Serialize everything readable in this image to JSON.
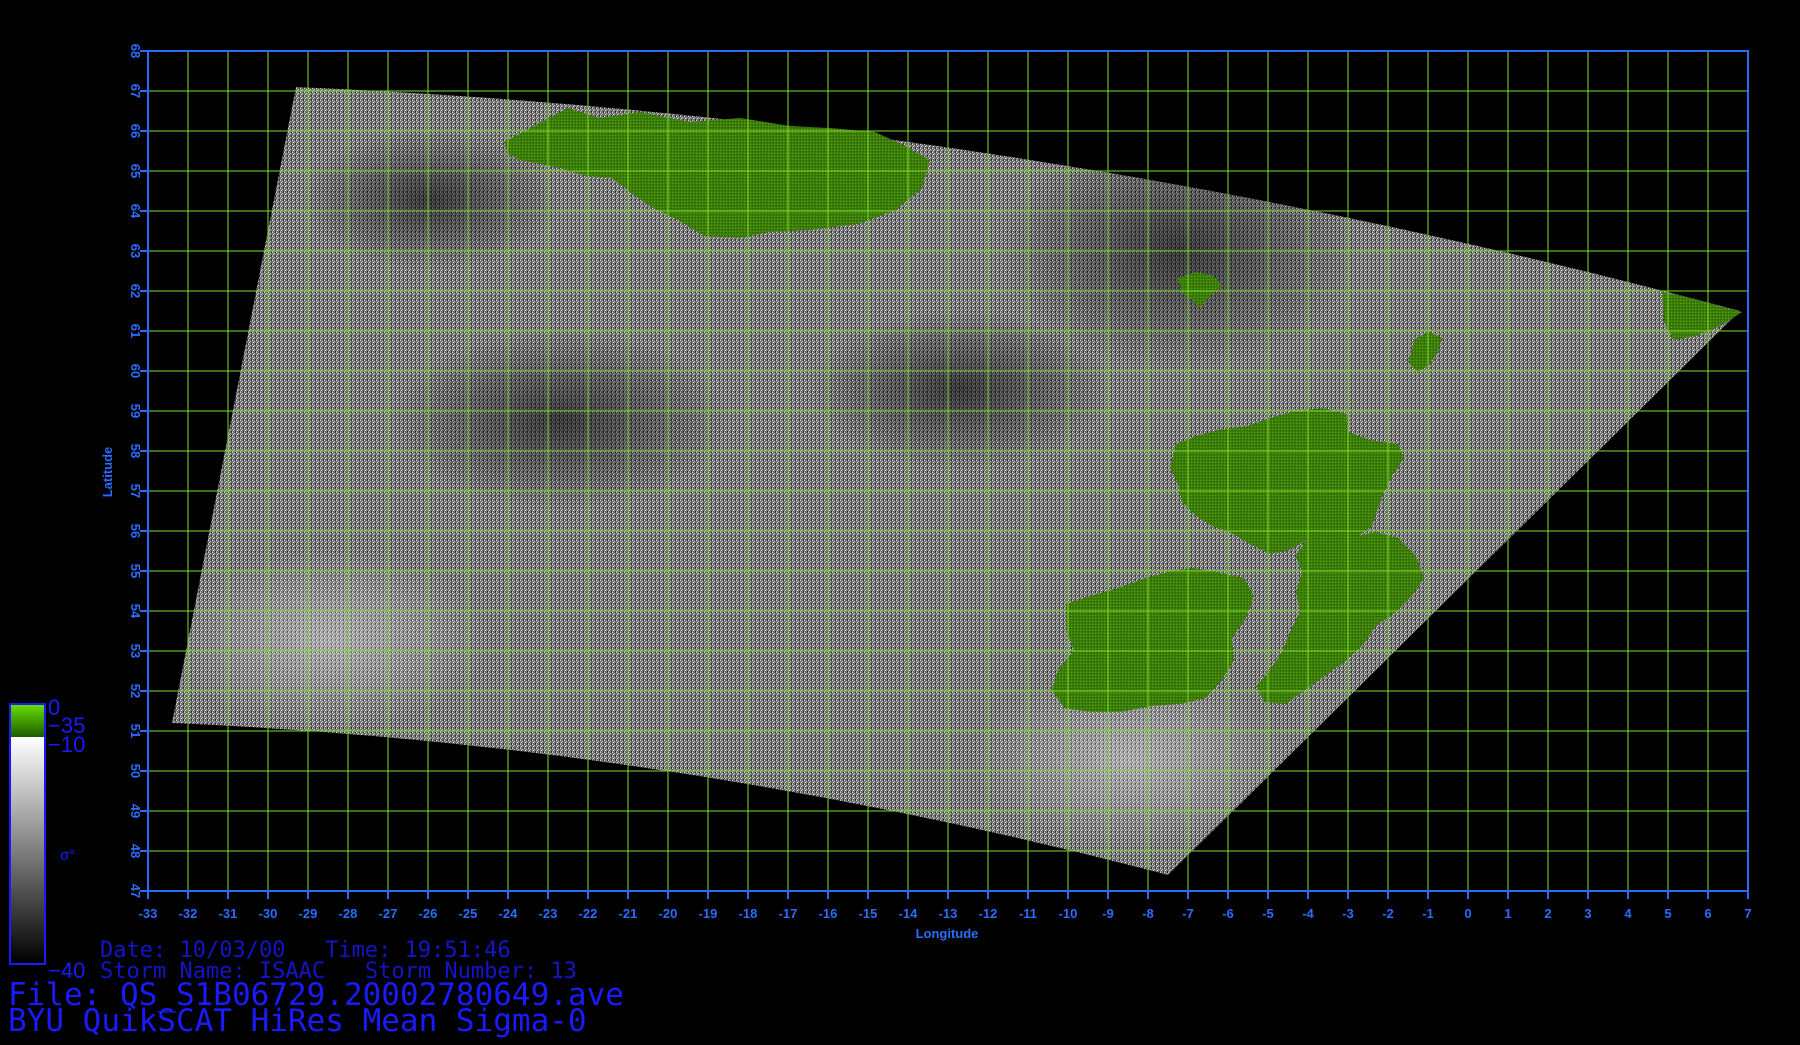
{
  "map": {
    "x_axis_label": "Longitude",
    "y_axis_label": "Latitude",
    "lon_ticks": [
      "-33",
      "-32",
      "-31",
      "-30",
      "-29",
      "-28",
      "-27",
      "-26",
      "-25",
      "-24",
      "-23",
      "-22",
      "-21",
      "-20",
      "-19",
      "-18",
      "-17",
      "-16",
      "-15",
      "-14",
      "-13",
      "-12",
      "-11",
      "-10",
      "-9",
      "-8",
      "-7",
      "-6",
      "-5",
      "-4",
      "-3",
      "-2",
      "-1",
      "0",
      "1",
      "2",
      "3",
      "4",
      "5",
      "6",
      "7"
    ],
    "lat_ticks": [
      "47",
      "48",
      "49",
      "50",
      "51",
      "52",
      "53",
      "54",
      "55",
      "56",
      "57",
      "58",
      "59",
      "60",
      "61",
      "62",
      "63",
      "64",
      "65",
      "66",
      "67",
      "68"
    ],
    "lon_range": [
      -33,
      7
    ],
    "lat_range": [
      47,
      68
    ],
    "grid": true,
    "grid_color": "#7cdc2a",
    "axis_color": "#2a6cff",
    "land_color": "#3a7a0a",
    "swath_corners_lonlat": [
      [
        -29.3,
        67.1
      ],
      [
        6.8,
        61.5
      ],
      [
        -7.5,
        47.4
      ],
      [
        -32.4,
        51.2
      ]
    ],
    "landmasses": [
      "Iceland",
      "Faroe Islands",
      "Shetland",
      "Scotland",
      "Ireland",
      "Great Britain",
      "Norway coast"
    ]
  },
  "colorbar": {
    "land_top_label": "0",
    "land_bottom_label": "−35",
    "ocean_top_label": "−10",
    "ocean_bottom_label": "−40",
    "quantity_label": "σ°"
  },
  "meta": {
    "date_line": "Date: 10/03/00   Time: 19:51:46",
    "storm_line": "Storm Name: ISAAC   Storm Number: 13"
  },
  "file_line": "File: QS_S1B06729.20002780649.ave",
  "product_line": "BYU QuikSCAT HiRes Mean Sigma-0"
}
